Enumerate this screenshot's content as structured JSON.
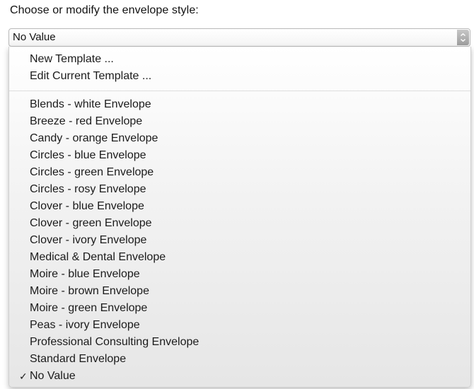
{
  "prompt": "Choose or modify the envelope style:",
  "select": {
    "value": "No Value",
    "arrow_icon": "chevron-down-icon"
  },
  "menu": {
    "actions": [
      "New Template ...",
      "Edit Current Template ..."
    ],
    "items": [
      "Blends - white Envelope",
      "Breeze - red Envelope",
      "Candy - orange Envelope",
      "Circles - blue Envelope",
      "Circles - green Envelope",
      "Circles - rosy Envelope",
      "Clover - blue Envelope",
      "Clover - green Envelope",
      "Clover - ivory Envelope",
      "Medical & Dental Envelope",
      "Moire - blue Envelope",
      "Moire - brown Envelope",
      "Moire - green Envelope",
      "Peas - ivory Envelope",
      "Professional Consulting Envelope",
      "Standard Envelope",
      "No Value"
    ],
    "selected_index": 16,
    "check_glyph": "✓"
  }
}
